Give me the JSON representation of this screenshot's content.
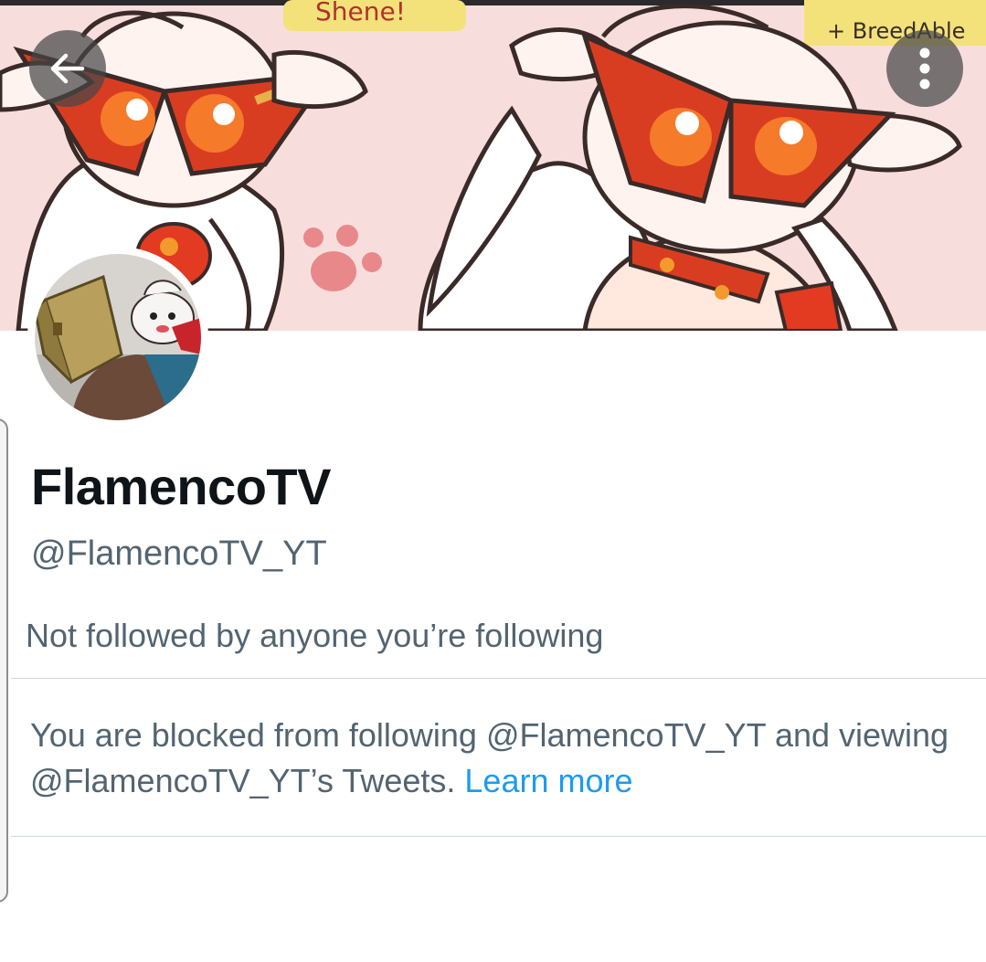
{
  "banner": {
    "background_color": "#f7dedd",
    "art_text": [
      "Shene!",
      "+ BreedAble"
    ]
  },
  "header": {
    "back_icon": "arrow-left-icon",
    "more_icon": "more-vertical-icon"
  },
  "profile": {
    "display_name": "FlamencoTV",
    "handle": "@FlamencoTV_YT",
    "followers_note": "Not followed by anyone you’re following"
  },
  "blocked": {
    "message": "You are blocked from following @FlamencoTV_YT and viewing @FlamencoTV_YT’s Tweets.",
    "link_label": "Learn more"
  },
  "colors": {
    "primary_text": "#0f1419",
    "secondary_text": "#536471",
    "link": "#1d9bf0",
    "divider": "#cfd9de"
  }
}
